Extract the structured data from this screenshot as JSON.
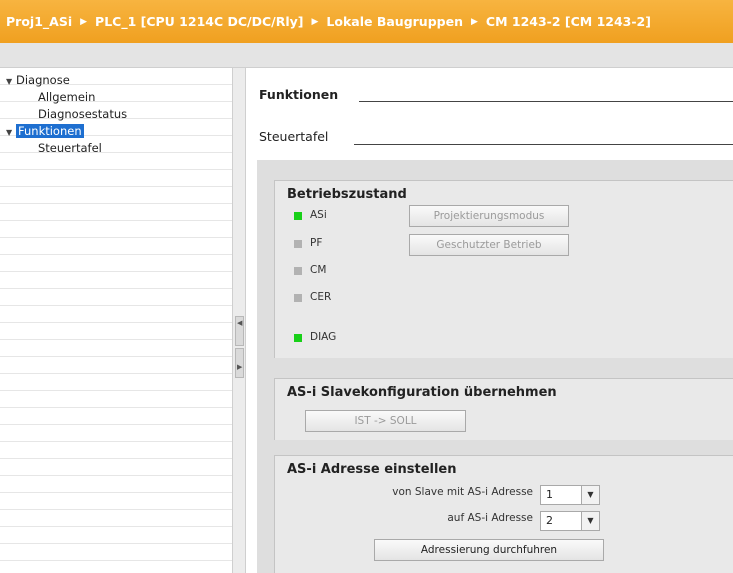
{
  "breadcrumb": {
    "items": [
      "Proj1_ASi",
      "PLC_1 [CPU 1214C DC/DC/Rly]",
      "Lokale Baugruppen",
      "CM 1243-2 [CM 1243-2]"
    ],
    "separator": "▶"
  },
  "sidebar": {
    "items": [
      {
        "label": "Diagnose",
        "expanded": true
      },
      {
        "label": "Allgemein"
      },
      {
        "label": "Diagnosestatus"
      },
      {
        "label": "Funktionen",
        "expanded": true,
        "selected": true
      },
      {
        "label": "Steuertafel"
      }
    ],
    "expanded_icon": "▼"
  },
  "main": {
    "heading": "Funktionen",
    "subheading": "Steuertafel"
  },
  "betriebszustand": {
    "title": "Betriebszustand",
    "leds": [
      {
        "label": "ASi",
        "state": "on",
        "color": "#18d018"
      },
      {
        "label": "PF",
        "state": "off",
        "color": "#b2b2b2"
      },
      {
        "label": "CM",
        "state": "off",
        "color": "#b2b2b2"
      },
      {
        "label": "CER",
        "state": "off",
        "color": "#b2b2b2"
      },
      {
        "label": "DIAG",
        "state": "on",
        "color": "#18d018"
      }
    ],
    "btn_projektierung": "Projektierungsmodus",
    "btn_geschuetzt": "Geschutzter Betrieb"
  },
  "slavekonfig": {
    "title": "AS-i Slavekonfiguration übernehmen",
    "btn_ist_soll": "IST -> SOLL"
  },
  "adresse": {
    "title": "AS-i Adresse einstellen",
    "from_label": "von Slave mit AS-i Adresse",
    "from_value": "1",
    "to_label": "auf AS-i Adresse",
    "to_value": "2",
    "btn_ausfuehren": "Adressierung durchfuhren"
  },
  "colors": {
    "titlebar": "#f0a020",
    "selection": "#1e6fd0",
    "led_on": "#18d018",
    "led_off": "#b2b2b2"
  }
}
